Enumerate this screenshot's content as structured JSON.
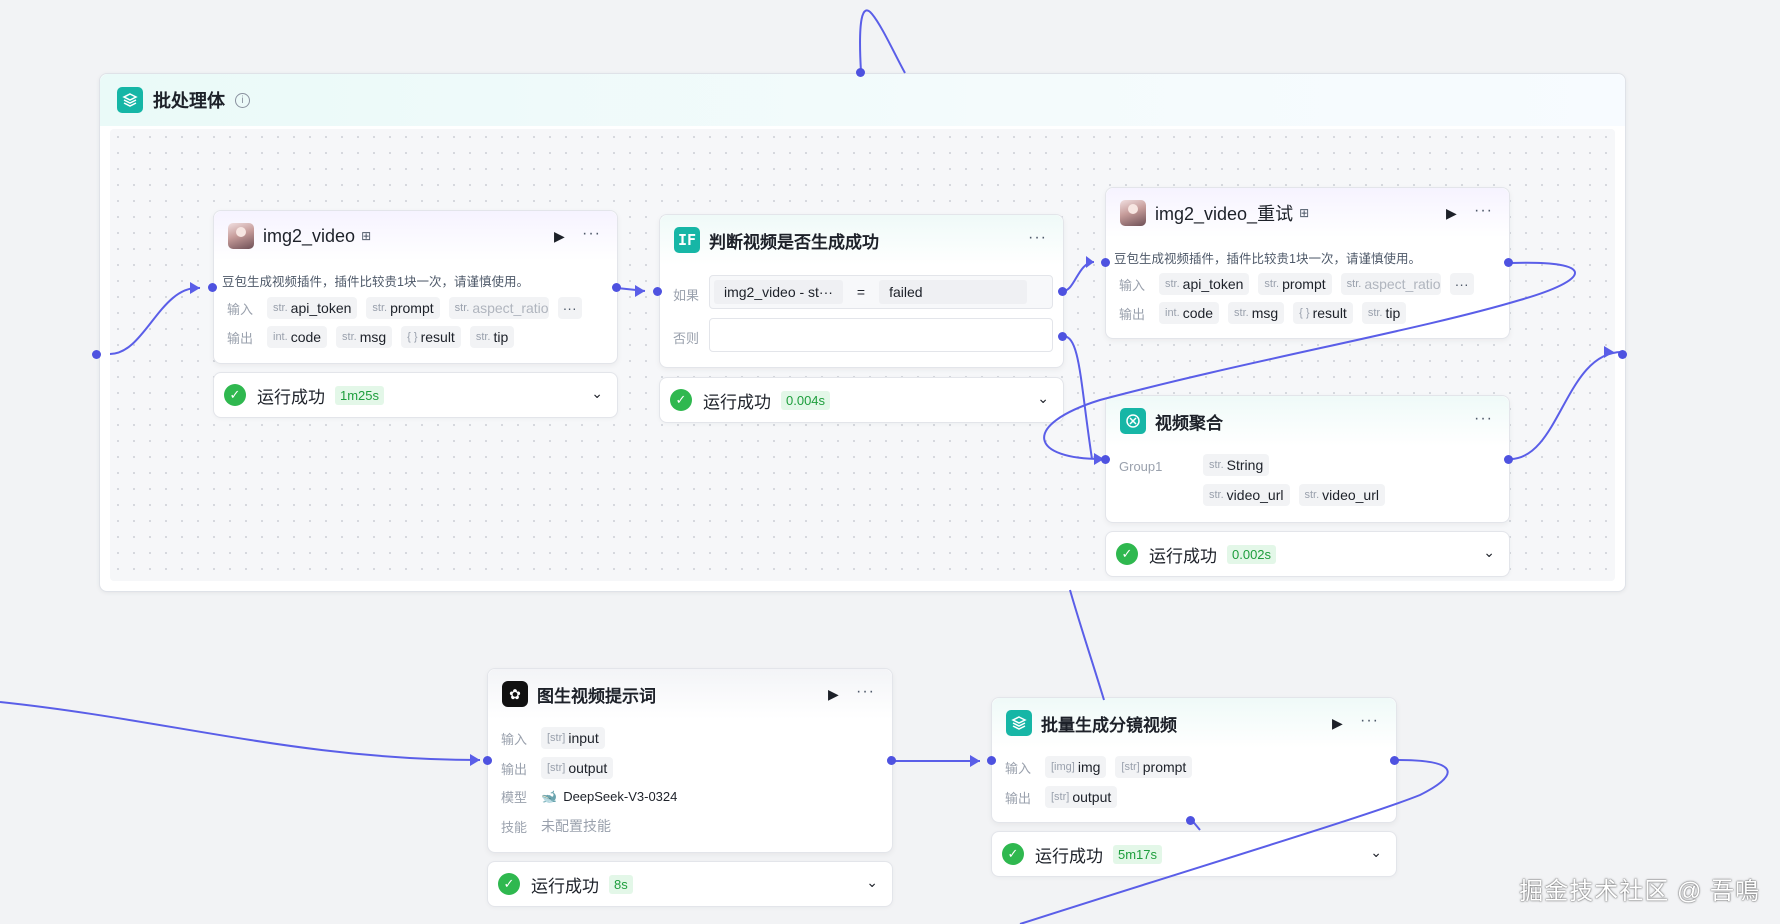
{
  "group": {
    "title": "批处理体"
  },
  "node1": {
    "title": "img2_video",
    "desc": "豆包生成视频插件，插件比较贵1块一次，请谨慎使用。",
    "input_label": "输入",
    "output_label": "输出",
    "inputs": [
      {
        "type": "str.",
        "name": "api_token"
      },
      {
        "type": "str.",
        "name": "prompt"
      },
      {
        "type": "str.",
        "name": "aspect_ratio"
      }
    ],
    "outputs": [
      {
        "type": "int.",
        "name": "code"
      },
      {
        "type": "str.",
        "name": "msg"
      },
      {
        "type": "{ }",
        "name": "result"
      },
      {
        "type": "str.",
        "name": "tip"
      }
    ],
    "status": "运行成功",
    "time": "1m25s"
  },
  "node2": {
    "title": "判断视频是否生成成功",
    "if_label": "如果",
    "else_label": "否则",
    "left": "img2_video - st···",
    "op": "=",
    "right": "failed",
    "status": "运行成功",
    "time": "0.004s"
  },
  "node3": {
    "title": "img2_video_重试",
    "desc": "豆包生成视频插件，插件比较贵1块一次，请谨慎使用。",
    "input_label": "输入",
    "output_label": "输出",
    "inputs": [
      {
        "type": "str.",
        "name": "api_token"
      },
      {
        "type": "str.",
        "name": "prompt"
      },
      {
        "type": "str.",
        "name": "aspect_ratio"
      }
    ],
    "outputs": [
      {
        "type": "int.",
        "name": "code"
      },
      {
        "type": "str.",
        "name": "msg"
      },
      {
        "type": "{ }",
        "name": "result"
      },
      {
        "type": "str.",
        "name": "tip"
      }
    ]
  },
  "node4": {
    "title": "视频聚合",
    "group_label": "Group1",
    "group_type": {
      "type": "str.",
      "name": "String"
    },
    "vars": [
      {
        "type": "str.",
        "name": "video_url"
      },
      {
        "type": "str.",
        "name": "video_url"
      }
    ],
    "status": "运行成功",
    "time": "0.002s"
  },
  "node5": {
    "title": "图生视频提示词",
    "input_label": "输入",
    "output_label": "输出",
    "model_label": "模型",
    "skill_label": "技能",
    "input": {
      "type": "[str]",
      "name": "input"
    },
    "output": {
      "type": "[str]",
      "name": "output"
    },
    "model": "DeepSeek-V3-0324",
    "skill": "未配置技能",
    "status": "运行成功",
    "time": "8s"
  },
  "node6": {
    "title": "批量生成分镜视频",
    "input_label": "输入",
    "output_label": "输出",
    "inputs": [
      {
        "type": "[img]",
        "name": "img"
      },
      {
        "type": "[str]",
        "name": "prompt"
      }
    ],
    "output": {
      "type": "[str]",
      "name": "output"
    },
    "status": "运行成功",
    "time": "5m17s"
  },
  "watermark": "掘金技术社区 @ 吾鳴",
  "colors": {
    "wire": "#5a5ee8",
    "port": "#4e52e0",
    "success": "#2fb84f",
    "brand": "#16b6a6"
  }
}
